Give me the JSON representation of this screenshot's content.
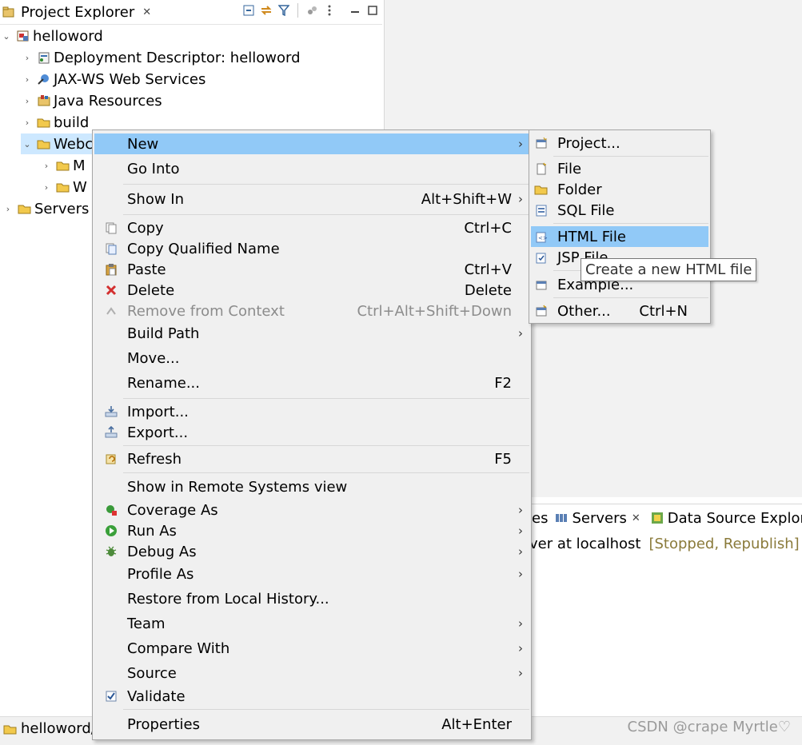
{
  "explorer": {
    "title": "Project Explorer",
    "tree": [
      {
        "label": "helloword",
        "icon": "project-icon"
      },
      {
        "label": "Deployment Descriptor: helloword",
        "icon": "deployment-descriptor-icon"
      },
      {
        "label": "JAX-WS Web Services",
        "icon": "web-services-icon"
      },
      {
        "label": "Java Resources",
        "icon": "java-resources-icon"
      },
      {
        "label": "build",
        "icon": "folder-icon"
      },
      {
        "label": "Webc",
        "icon": "folder-icon"
      },
      {
        "label": "M",
        "icon": "folder-icon"
      },
      {
        "label": "W",
        "icon": "folder-icon"
      },
      {
        "label": "Servers",
        "icon": "folder-icon"
      }
    ]
  },
  "context_menu": {
    "items": [
      {
        "label": "New",
        "shortcut": "",
        "icon": ""
      },
      {
        "label": "Go Into",
        "shortcut": "",
        "icon": ""
      },
      {
        "label": "Show In",
        "shortcut": "Alt+Shift+W",
        "icon": ""
      },
      {
        "label": "Copy",
        "shortcut": "Ctrl+C",
        "icon": "copy-icon"
      },
      {
        "label": "Copy Qualified Name",
        "shortcut": "",
        "icon": "copy-qualified-icon"
      },
      {
        "label": "Paste",
        "shortcut": "Ctrl+V",
        "icon": "paste-icon"
      },
      {
        "label": "Delete",
        "shortcut": "Delete",
        "icon": "delete-icon"
      },
      {
        "label": "Remove from Context",
        "shortcut": "Ctrl+Alt+Shift+Down",
        "icon": "remove-context-icon"
      },
      {
        "label": "Build Path",
        "shortcut": "",
        "icon": ""
      },
      {
        "label": "Move...",
        "shortcut": "",
        "icon": ""
      },
      {
        "label": "Rename...",
        "shortcut": "F2",
        "icon": ""
      },
      {
        "label": "Import...",
        "shortcut": "",
        "icon": "import-icon"
      },
      {
        "label": "Export...",
        "shortcut": "",
        "icon": "export-icon"
      },
      {
        "label": "Refresh",
        "shortcut": "F5",
        "icon": "refresh-icon"
      },
      {
        "label": "Show in Remote Systems view",
        "shortcut": "",
        "icon": ""
      },
      {
        "label": "Coverage As",
        "shortcut": "",
        "icon": "coverage-icon"
      },
      {
        "label": "Run As",
        "shortcut": "",
        "icon": "run-icon"
      },
      {
        "label": "Debug As",
        "shortcut": "",
        "icon": "debug-icon"
      },
      {
        "label": "Profile As",
        "shortcut": "",
        "icon": ""
      },
      {
        "label": "Restore from Local History...",
        "shortcut": "",
        "icon": ""
      },
      {
        "label": "Team",
        "shortcut": "",
        "icon": ""
      },
      {
        "label": "Compare With",
        "shortcut": "",
        "icon": ""
      },
      {
        "label": "Source",
        "shortcut": "",
        "icon": ""
      },
      {
        "label": "Validate",
        "shortcut": "",
        "icon": "checkbox-checked-icon"
      },
      {
        "label": "Properties",
        "shortcut": "Alt+Enter",
        "icon": ""
      }
    ]
  },
  "submenu": {
    "items": [
      {
        "label": "Project...",
        "shortcut": "",
        "icon": "new-project-icon"
      },
      {
        "label": "File",
        "shortcut": "",
        "icon": "new-file-icon"
      },
      {
        "label": "Folder",
        "shortcut": "",
        "icon": "new-folder-icon"
      },
      {
        "label": "SQL File",
        "shortcut": "",
        "icon": "sql-file-icon"
      },
      {
        "label": "HTML File",
        "shortcut": "",
        "icon": "html-file-icon"
      },
      {
        "label": "JSP File",
        "shortcut": "",
        "icon": "jsp-file-icon"
      },
      {
        "label": "Example...",
        "shortcut": "",
        "icon": "example-icon"
      },
      {
        "label": "Other...",
        "shortcut": "Ctrl+N",
        "icon": "other-wizard-icon"
      }
    ]
  },
  "tooltip": "Create a new HTML file",
  "bottom_panel": {
    "tabs": [
      "ies",
      "Servers",
      "Data Source Explore"
    ],
    "server_row": {
      "name": "ver at localhost",
      "status": "[Stopped, Republish]"
    }
  },
  "statusbar": {
    "path": "helloword/",
    "watermark": "CSDN @crape Myrtle♡"
  },
  "colors": {
    "menu_highlight": "#91c9f7",
    "tree_selection": "#cde8ff",
    "menu_background": "#f0f0f0",
    "server_status": "#8a7a3a"
  }
}
